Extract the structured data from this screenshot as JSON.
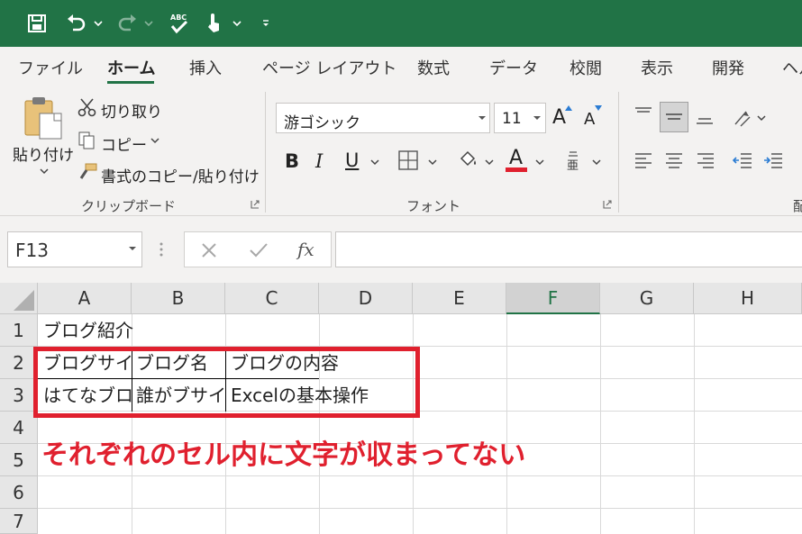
{
  "ribbon_tabs": {
    "file": "ファイル",
    "home": "ホーム",
    "insert": "挿入",
    "page_layout": "ページ レイアウト",
    "formulas": "数式",
    "data": "データ",
    "review": "校閲",
    "view": "表示",
    "developer": "開発",
    "help": "ヘル"
  },
  "clipboard": {
    "paste": "貼り付け",
    "cut": "切り取り",
    "copy": "コピー",
    "format_painter": "書式のコピー/貼り付け",
    "group_label": "クリップボード"
  },
  "font": {
    "name": "游ゴシック",
    "size": "11",
    "bold": "B",
    "italic": "I",
    "underline": "U",
    "font_color_letter": "A",
    "grow": "A",
    "shrink": "A",
    "group_label": "フォント",
    "font_color_hex": "#e0202e"
  },
  "alignment": {
    "group_label_partial": "配"
  },
  "formula_bar": {
    "name_box": "F13",
    "fx": "fx",
    "value": ""
  },
  "columns": [
    "A",
    "B",
    "C",
    "D",
    "E",
    "F",
    "G",
    "H"
  ],
  "selected_column": "F",
  "rows": [
    "1",
    "2",
    "3",
    "4",
    "5",
    "6",
    "7"
  ],
  "cells": {
    "A1": "ブログ紹介",
    "A2": "ブログサイト",
    "B2": "ブログ名",
    "C2": "ブログの内容",
    "A3": "はてなブログ",
    "B3": "誰がブサイクやねん",
    "C3": "Excelの基本操作"
  },
  "annotation": "それぞれのセル内に文字が収まってない",
  "colors": {
    "title_bar": "#217346",
    "accent": "#217346",
    "highlight": "#e0202e"
  }
}
